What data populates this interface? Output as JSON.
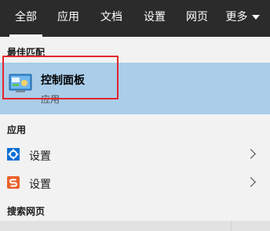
{
  "tabs": [
    {
      "label": "全部",
      "active": true
    },
    {
      "label": "应用"
    },
    {
      "label": "文档"
    },
    {
      "label": "设置"
    },
    {
      "label": "网页"
    },
    {
      "label": "更多"
    }
  ],
  "sections": {
    "best_match": "最佳匹配",
    "apps": "应用",
    "web_search": "搜索网页"
  },
  "best_match": {
    "name": "控制面板",
    "type": "应用",
    "icon": "control-panel-icon"
  },
  "apps": [
    {
      "label": "设置",
      "icon": "gear-icon"
    },
    {
      "label": "设置",
      "icon": "settings-s-icon"
    }
  ],
  "colors": {
    "tabbar": "#2b2b2b",
    "selection": "#aacde9",
    "highlight_border": "#e3262e"
  }
}
